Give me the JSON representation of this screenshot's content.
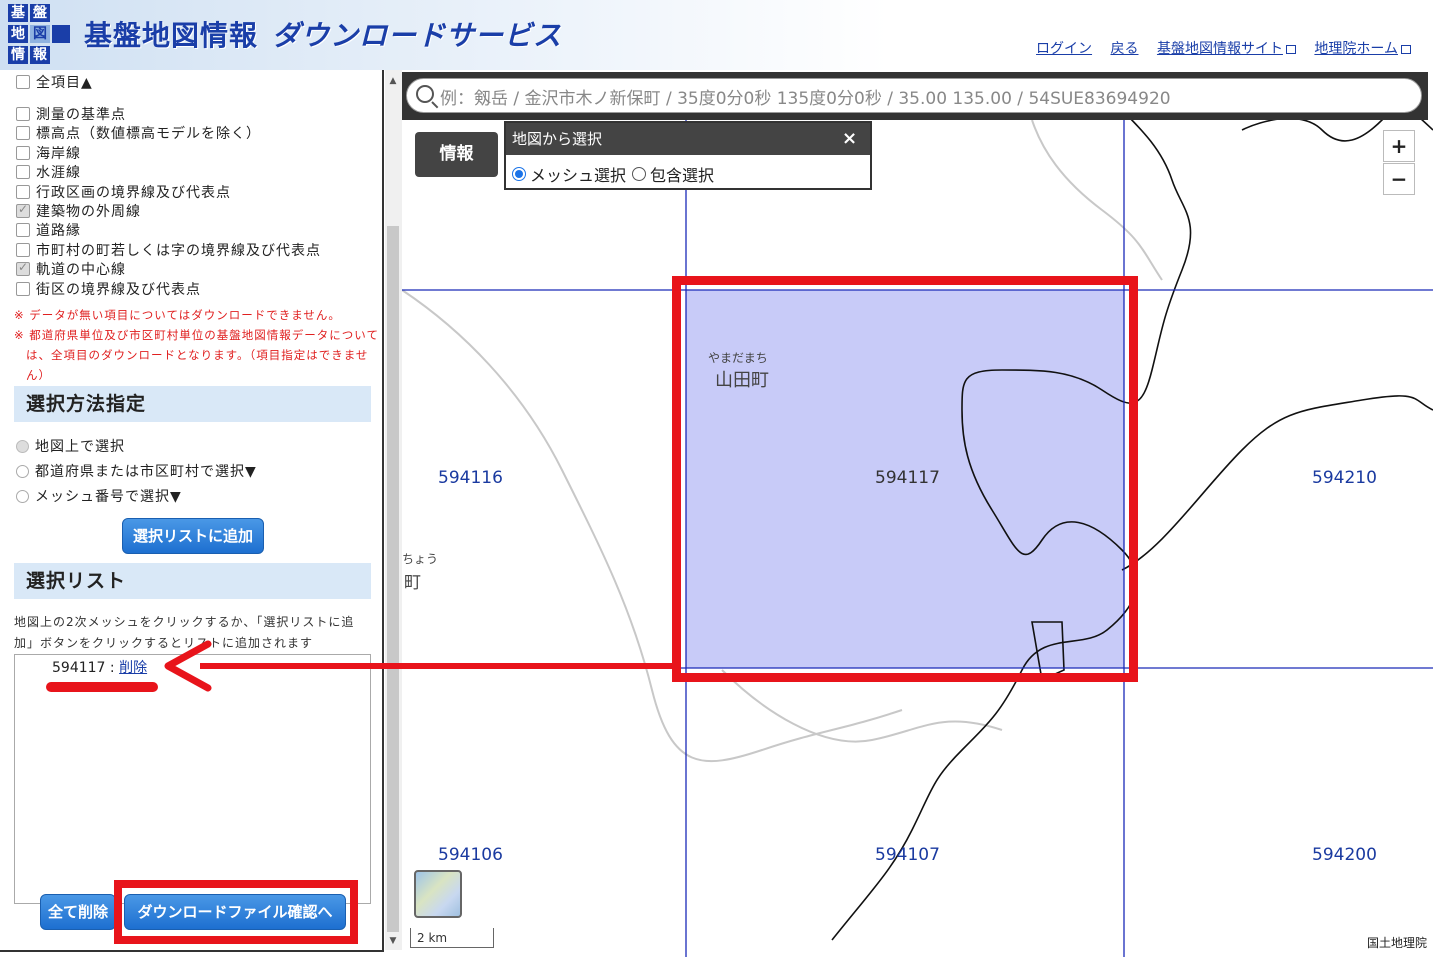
{
  "header": {
    "logo": {
      "cells": [
        "基",
        "盤",
        "地",
        "図",
        "情",
        "報"
      ]
    },
    "title_main": "基盤地図情報",
    "title_sub": "ダウンロードサービス",
    "links": {
      "login": "ログイン",
      "back": "戻る",
      "fgd_site": "基盤地図情報サイト",
      "gsi_home": "地理院ホーム"
    }
  },
  "left_panel": {
    "items": [
      {
        "label": "全項目▲",
        "checked": false
      },
      {
        "label": "測量の基準点",
        "checked": false
      },
      {
        "label": "標高点（数値標高モデルを除く）",
        "checked": false
      },
      {
        "label": "海岸線",
        "checked": false
      },
      {
        "label": "水涯線",
        "checked": false
      },
      {
        "label": "行政区画の境界線及び代表点",
        "checked": false
      },
      {
        "label": "建築物の外周線",
        "checked": true
      },
      {
        "label": "道路縁",
        "checked": false
      },
      {
        "label": "市町村の町若しくは字の境界線及び代表点",
        "checked": false
      },
      {
        "label": "軌道の中心線",
        "checked": true
      },
      {
        "label": "街区の境界線及び代表点",
        "checked": false
      }
    ],
    "notes": {
      "note1": "※ データが無い項目についてはダウンロードできません。",
      "note2_line1": "※ 都道府県単位及び市区町村単位の基盤地図情報データについて",
      "note2_line2": "は、全項目のダウンロードとなります。（項目指定はできませ",
      "note2_line3": "ん）"
    },
    "selection_method": {
      "header": "選択方法指定",
      "options": [
        {
          "label": "地図上で選択",
          "checked": true
        },
        {
          "label": "都道府県または市区町村で選択▼",
          "checked": false
        },
        {
          "label": "メッシュ番号で選択▼",
          "checked": false
        }
      ],
      "add_button": "選択リストに追加"
    },
    "selection_list": {
      "header": "選択リスト",
      "help_line1": "地図上の2次メッシュをクリックするか、「選択リストに追",
      "help_line2": "加」ボタンをクリックするとリストに追加されます",
      "item_code": "594117",
      "item_sep": " : ",
      "item_delete": "削除",
      "delete_all_button": "全て削除",
      "confirm_button": "ダウンロードファイル確認へ"
    }
  },
  "map": {
    "search_placeholder": "例：剱岳 / 金沢市木ノ新保町 / 35度0分0秒 135度0分0秒 / 35.00 135.00 / 54SUE83694920",
    "info_button": "情報",
    "map_select": {
      "title": "地図から選択",
      "close": "×",
      "option_mesh": "メッシュ選択",
      "option_include": "包含選択",
      "selected": "mesh"
    },
    "zoom_in": "+",
    "zoom_out": "−",
    "mesh_labels": [
      "594116",
      "594117",
      "594210",
      "594106",
      "594107",
      "594200"
    ],
    "selected_mesh": "594117",
    "place_kana": "やまだまち",
    "place_name": "山田町",
    "place_kana_2": "ちょう",
    "place_name_2": "町",
    "scale": "2 km",
    "attribution": "国土地理院"
  },
  "colors": {
    "mesh_line": "#1a2ab8",
    "selected_fill": "#c8cbf8",
    "annotation_red": "#e8141b",
    "header_blue": "#1a3ea8",
    "button_blue": "#1d6fd0"
  }
}
